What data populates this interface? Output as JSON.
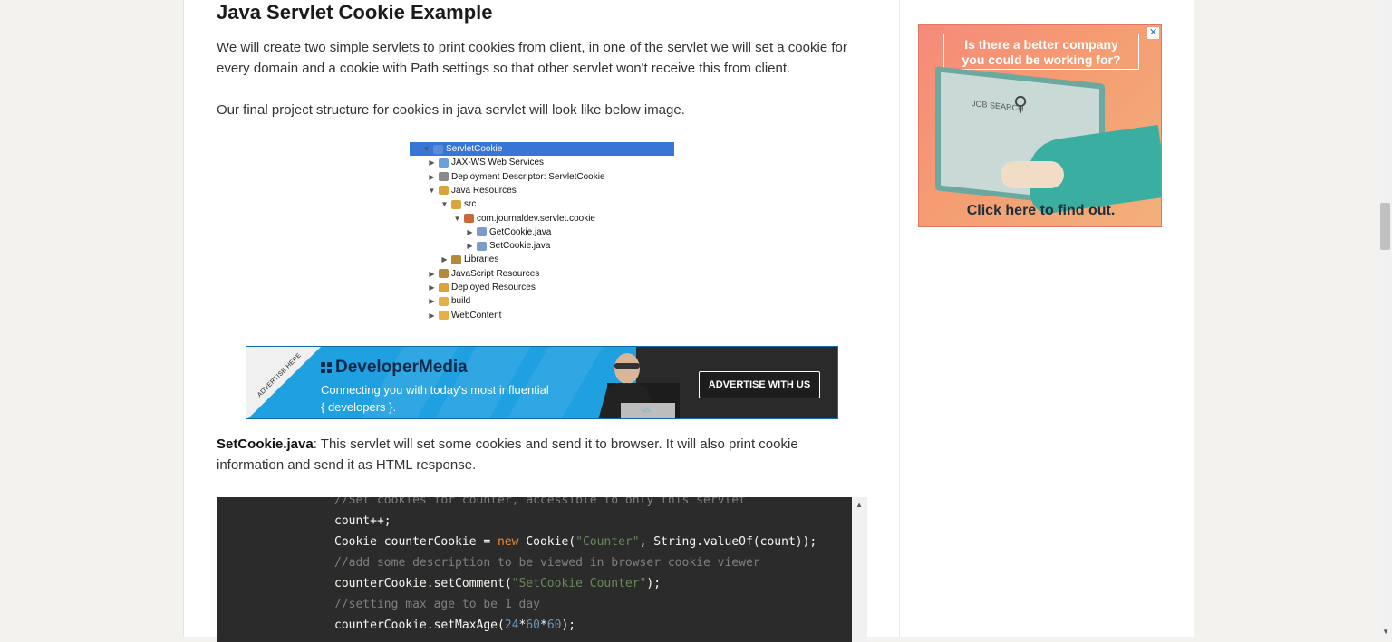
{
  "article": {
    "heading": "Java Servlet Cookie Example",
    "intro": "We will create two simple servlets to print cookies from client, in one of the servlet we will set a cookie for every domain and a cookie with Path settings so that other servlet won't receive this from client.",
    "structure_text": "Our final project structure for cookies in java servlet will look like below image.",
    "setcookie_name": "SetCookie.java",
    "setcookie_desc": ": This servlet will set some cookies and send it to browser. It will also print cookie information and send it as HTML response."
  },
  "project_tree": [
    {
      "label": "ServletCookie",
      "arrow": "▼",
      "icon_color": "#5b8cd6",
      "selected": true
    },
    {
      "label": "JAX-WS Web Services",
      "arrow": "▶",
      "icon_color": "#6aa0d8"
    },
    {
      "label": "Deployment Descriptor: ServletCookie",
      "arrow": "▶",
      "icon_color": "#8a8a8a"
    },
    {
      "label": "Java Resources",
      "arrow": "▼",
      "icon_color": "#d9a53a"
    },
    {
      "label": "src",
      "arrow": "▼",
      "icon_color": "#d9a53a"
    },
    {
      "label": "com.journaldev.servlet.cookie",
      "arrow": "▼",
      "icon_color": "#c9683a"
    },
    {
      "label": "GetCookie.java",
      "arrow": "▶",
      "icon_color": "#7a9cc8"
    },
    {
      "label": "SetCookie.java",
      "arrow": "▶",
      "icon_color": "#7a9cc8"
    },
    {
      "label": "Libraries",
      "arrow": "▶",
      "icon_color": "#b48a3a"
    },
    {
      "label": "JavaScript Resources",
      "arrow": "▶",
      "icon_color": "#b48a3a"
    },
    {
      "label": "Deployed Resources",
      "arrow": "▶",
      "icon_color": "#d9a53a"
    },
    {
      "label": "build",
      "arrow": "▶",
      "icon_color": "#e3b04a"
    },
    {
      "label": "WebContent",
      "arrow": "▶",
      "icon_color": "#e3b04a"
    }
  ],
  "banner": {
    "corner_text": "ADVERTISE HERE",
    "brand": "DeveloperMedia",
    "sub_line1": "Connecting you with today's most influential",
    "sub_line2": "{ developers }.",
    "button": "ADVERTISE WITH US"
  },
  "code_lines": [
    [
      {
        "t": "//Set cookies for counter, accessible to only this servlet",
        "c": "cm"
      }
    ],
    [
      {
        "t": "count++;",
        "c": ""
      }
    ],
    [
      {
        "t": "Cookie counterCookie = ",
        "c": ""
      },
      {
        "t": "new",
        "c": "kw"
      },
      {
        "t": " Cookie(",
        "c": ""
      },
      {
        "t": "\"Counter\"",
        "c": "str"
      },
      {
        "t": ", String.valueOf(count));",
        "c": ""
      }
    ],
    [
      {
        "t": "//add some description to be viewed in browser cookie viewer",
        "c": "cm"
      }
    ],
    [
      {
        "t": "counterCookie.setComment(",
        "c": ""
      },
      {
        "t": "\"SetCookie Counter\"",
        "c": "str"
      },
      {
        "t": ");",
        "c": ""
      }
    ],
    [
      {
        "t": "//setting max age to be 1 day",
        "c": "cm"
      }
    ],
    [
      {
        "t": "counterCookie.setMaxAge(",
        "c": ""
      },
      {
        "t": "24",
        "c": "num"
      },
      {
        "t": "*",
        "c": ""
      },
      {
        "t": "60",
        "c": "num"
      },
      {
        "t": "*",
        "c": ""
      },
      {
        "t": "60",
        "c": "num"
      },
      {
        "t": ");",
        "c": ""
      }
    ]
  ],
  "ad": {
    "headline_line1": "Is there a better company",
    "headline_line2": "you could be working for?",
    "search_label": "JOB SEARCH",
    "cta": "Click here to find out.",
    "close_icon": "close-icon"
  }
}
